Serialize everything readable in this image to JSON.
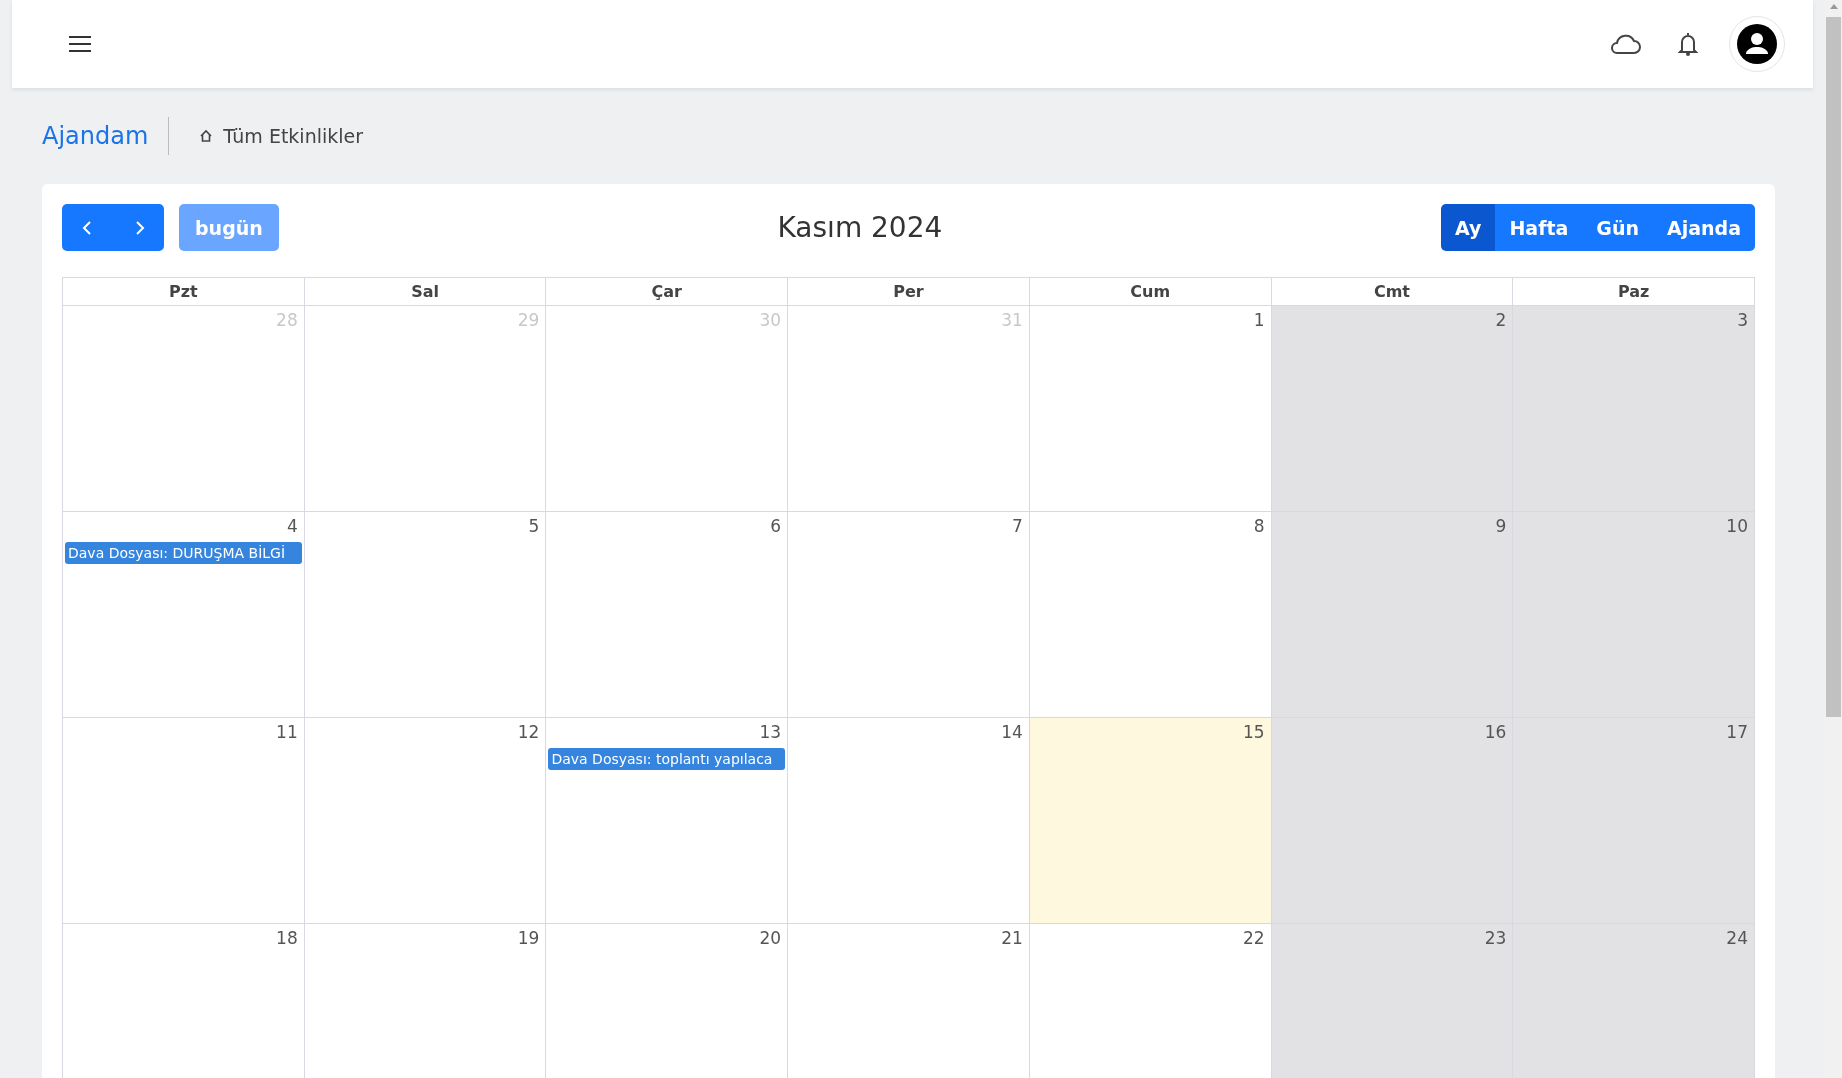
{
  "breadcrumb": {
    "title": "Ajandam",
    "current": "Tüm Etkinlikler"
  },
  "toolbar": {
    "today_button": "bugün",
    "today_disabled": true,
    "title": "Kasım 2024",
    "views": [
      {
        "label": "Ay",
        "selected": true
      },
      {
        "label": "Hafta",
        "selected": false
      },
      {
        "label": "Gün",
        "selected": false
      },
      {
        "label": "Ajanda",
        "selected": false
      }
    ]
  },
  "weekdays": [
    "Pzt",
    "Sal",
    "Çar",
    "Per",
    "Cum",
    "Cmt",
    "Paz"
  ],
  "weeks": [
    [
      {
        "day": "28",
        "other_month": true,
        "weekend": false,
        "today": false
      },
      {
        "day": "29",
        "other_month": true,
        "weekend": false,
        "today": false
      },
      {
        "day": "30",
        "other_month": true,
        "weekend": false,
        "today": false
      },
      {
        "day": "31",
        "other_month": true,
        "weekend": false,
        "today": false
      },
      {
        "day": "1",
        "other_month": false,
        "weekend": false,
        "today": false
      },
      {
        "day": "2",
        "other_month": false,
        "weekend": true,
        "today": false
      },
      {
        "day": "3",
        "other_month": false,
        "weekend": true,
        "today": false
      }
    ],
    [
      {
        "day": "4",
        "other_month": false,
        "weekend": false,
        "today": false,
        "events": [
          "Dava Dosyası: DURUŞMA BİLGİ"
        ]
      },
      {
        "day": "5",
        "other_month": false,
        "weekend": false,
        "today": false
      },
      {
        "day": "6",
        "other_month": false,
        "weekend": false,
        "today": false
      },
      {
        "day": "7",
        "other_month": false,
        "weekend": false,
        "today": false
      },
      {
        "day": "8",
        "other_month": false,
        "weekend": false,
        "today": false
      },
      {
        "day": "9",
        "other_month": false,
        "weekend": true,
        "today": false
      },
      {
        "day": "10",
        "other_month": false,
        "weekend": true,
        "today": false
      }
    ],
    [
      {
        "day": "11",
        "other_month": false,
        "weekend": false,
        "today": false
      },
      {
        "day": "12",
        "other_month": false,
        "weekend": false,
        "today": false
      },
      {
        "day": "13",
        "other_month": false,
        "weekend": false,
        "today": false,
        "events": [
          "Dava Dosyası: toplantı yapılaca"
        ]
      },
      {
        "day": "14",
        "other_month": false,
        "weekend": false,
        "today": false
      },
      {
        "day": "15",
        "other_month": false,
        "weekend": false,
        "today": true
      },
      {
        "day": "16",
        "other_month": false,
        "weekend": true,
        "today": false
      },
      {
        "day": "17",
        "other_month": false,
        "weekend": true,
        "today": false
      }
    ],
    [
      {
        "day": "18",
        "other_month": false,
        "weekend": false,
        "today": false
      },
      {
        "day": "19",
        "other_month": false,
        "weekend": false,
        "today": false
      },
      {
        "day": "20",
        "other_month": false,
        "weekend": false,
        "today": false
      },
      {
        "day": "21",
        "other_month": false,
        "weekend": false,
        "today": false
      },
      {
        "day": "22",
        "other_month": false,
        "weekend": false,
        "today": false
      },
      {
        "day": "23",
        "other_month": false,
        "weekend": true,
        "today": false
      },
      {
        "day": "24",
        "other_month": false,
        "weekend": true,
        "today": false
      }
    ]
  ]
}
